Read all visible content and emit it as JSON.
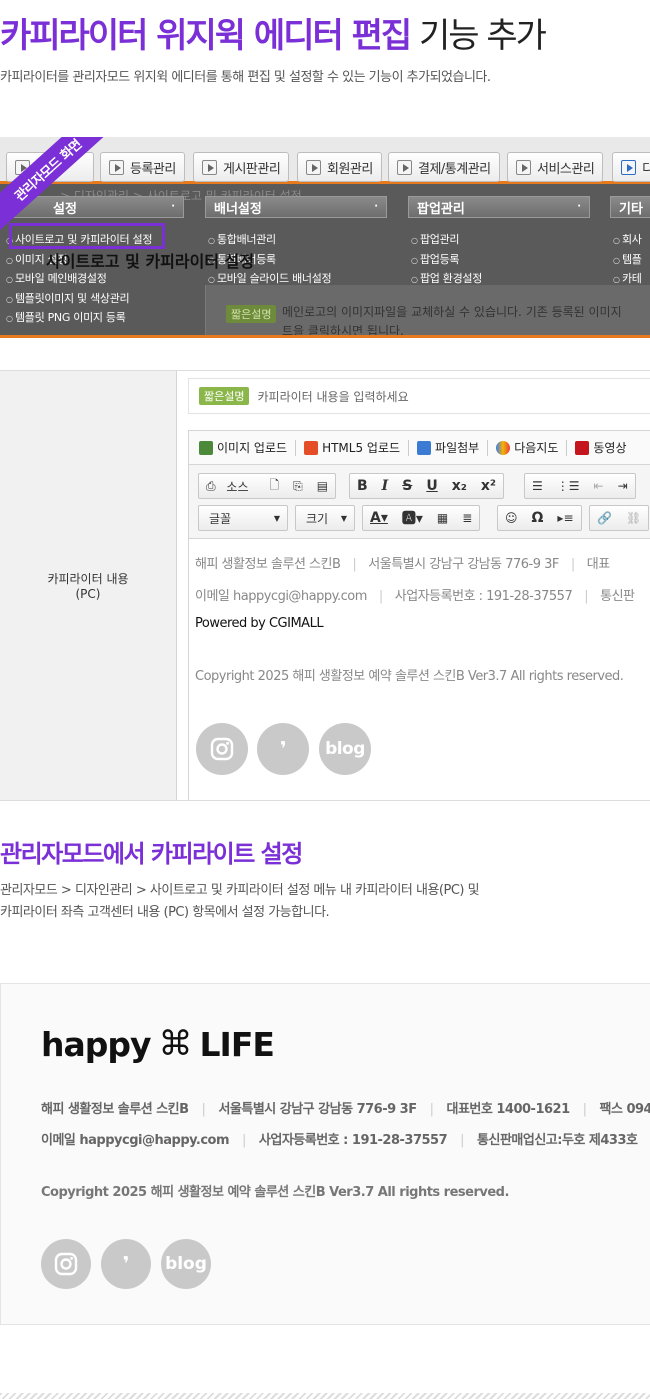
{
  "header": {
    "title_accent": "카피라이터 위지윅 에디터 편집",
    "title_rest": " 기능 추가",
    "subtitle": "카피라이터를 관리자모드 위지윅 에디터를 통해 편집 및 설정할 수 있는 기능이 추가되었습니다."
  },
  "admin": {
    "ribbon": "관리자모드 화면",
    "tabs": [
      "등록관리",
      "게시판관리",
      "회원관리",
      "결제/통계관리",
      "서비스관리",
      "디"
    ],
    "breadcrumb": "> 디자인관리 > 사이트로고 및 카피라이터 설정",
    "menus": [
      {
        "title": "설정",
        "items": [
          "사이트로고 및 카피라이터 설정",
          "이미지 설정",
          "모바일 메인배경설정",
          "템플릿이미지 및 색상관리",
          "템플릿 PNG 이미지 등록"
        ]
      },
      {
        "title": "배너설정",
        "items": [
          "통합배너관리",
          "통합배너등록",
          "모바일 슬라이드 배너설정"
        ]
      },
      {
        "title": "팝업관리",
        "items": [
          "팝업관리",
          "팝업등록",
          "팝업 환경설정"
        ]
      },
      {
        "title": "기타",
        "items": [
          "회사",
          "템플",
          "카테"
        ]
      }
    ],
    "overlay_title": "사이트로고 및 카피라이터 설정",
    "panel_badge": "짧은설명",
    "panel_text_1": "메인로고의 이미지파일을 교체하실 수 있습니다. 기존 등록된 이미지",
    "panel_text_2": "트을 클릭하시면 됩니다."
  },
  "editor": {
    "label_line1": "카피라이터 내용",
    "label_line2": "(PC)",
    "hint_badge": "짧은설명",
    "hint_text": "카피라이터 내용을 입력하세요",
    "uploads": [
      "이미지 업로드",
      "HTML5 업로드",
      "파일첨부",
      "다음지도",
      "동영상"
    ],
    "source_label": "소스",
    "font_label": "글꼴",
    "size_label": "크기",
    "content": {
      "line1": [
        "해피 생활정보 솔루션 스킨B",
        "서울특별시 강남구 강남동 776-9 3F",
        "대표"
      ],
      "line2": [
        "이메일 happycgi@happy.com",
        "사업자등록번호 : 191-28-37557",
        "통신판"
      ],
      "powered": "Powered by CGIMALL",
      "copyright": "Copyright 2025 해피 생활정보 예약 솔루션 스킨B Ver3.7 All rights reserved.",
      "social": [
        "instagram",
        "kakao",
        "blog"
      ]
    }
  },
  "section2": {
    "title": "관리자모드에서 카피라이트 설정",
    "desc_line1": "관리자모드 > 디자인관리 > 사이트로고 및 카피라이터 설정 메뉴 내 카피라이터 내용(PC) 및",
    "desc_line2": "카피라이터 좌측 고객센터 내용 (PC) 항목에서 설정 가능합니다."
  },
  "footer": {
    "logo_text_1": "happy",
    "logo_symbol": "⌘",
    "logo_text_2": "LIFE",
    "line1": [
      "해피 생활정보 솔루션 스킨B",
      "서울특별시 강남구 강남동 776-9 3F",
      "대표번호 1400-1621",
      "팩스 094-"
    ],
    "line2": [
      "이메일 happycgi@happy.com",
      "사업자등록번호 : 191-28-37557",
      "통신판매업신고:두호 제433호"
    ],
    "copyright": "Copyright 2025 해피 생활정보 예약 솔루션 스킨B Ver3.7 All rights reserved.",
    "social_blog": "blog",
    "social_kakao": "❜"
  }
}
